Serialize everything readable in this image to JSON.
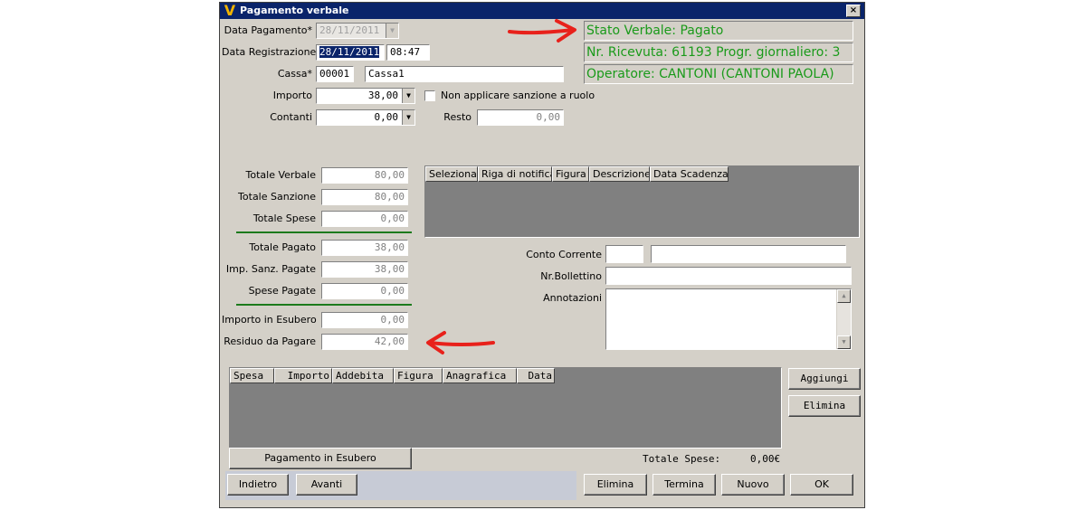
{
  "window": {
    "title": "Pagamento verbale",
    "close_glyph": "×",
    "logo_glyph": "V"
  },
  "form": {
    "data_pagamento_label": "Data Pagamento*",
    "data_pagamento_value": "28/11/2011",
    "data_registrazione_label": "Data Registrazione",
    "data_registrazione_date": "28/11/2011",
    "data_registrazione_time": "08:47",
    "cassa_label": "Cassa*",
    "cassa_code": "00001",
    "cassa_name": "Cassa1",
    "importo_label": "Importo",
    "importo_value": "38,00",
    "non_applicare_label": "Non applicare sanzione a ruolo",
    "contanti_label": "Contanti",
    "contanti_value": "0,00",
    "resto_label": "Resto",
    "resto_value": "0,00"
  },
  "status": {
    "stato": "Stato Verbale: Pagato",
    "ricevuta": "Nr. Ricevuta: 61193 Progr. giornaliero: 3",
    "operatore": "Operatore: CANTONI (CANTONI PAOLA)"
  },
  "totals": {
    "totale_verbale_label": "Totale Verbale",
    "totale_verbale": "80,00",
    "totale_sanzione_label": "Totale Sanzione",
    "totale_sanzione": "80,00",
    "totale_spese_label": "Totale Spese",
    "totale_spese": "0,00",
    "totale_pagato_label": "Totale Pagato",
    "totale_pagato": "38,00",
    "imp_sanz_pagate_label": "Imp. Sanz. Pagate",
    "imp_sanz_pagate": "38,00",
    "spese_pagate_label": "Spese Pagate",
    "spese_pagate": "0,00",
    "importo_esubero_label": "Importo in Esubero",
    "importo_esubero": "0,00",
    "residuo_label": "Residuo da Pagare",
    "residuo": "42,00"
  },
  "notifica_grid": {
    "columns": [
      "Seleziona",
      "Riga di notifica",
      "Figura",
      "Descrizione",
      "Data Scadenza"
    ]
  },
  "bank": {
    "conto_corrente_label": "Conto Corrente",
    "conto_corrente_code": "",
    "conto_corrente_desc": "",
    "nr_bollettino_label": "Nr.Bollettino",
    "nr_bollettino_value": "",
    "annotazioni_label": "Annotazioni",
    "annotazioni_value": ""
  },
  "spese_grid": {
    "columns": [
      "Spesa",
      "Importo",
      "Addebita",
      "Figura",
      "Anagrafica",
      "Data"
    ],
    "totale_label": "Totale Spese:",
    "totale_value": "0,00€"
  },
  "buttons": {
    "aggiungi": "Aggiungi",
    "elimina_side": "Elimina",
    "pagamento_esubero": "Pagamento in Esubero",
    "indietro": "Indietro",
    "avanti": "Avanti",
    "elimina": "Elimina",
    "termina": "Termina",
    "nuovo": "Nuovo",
    "ok": "OK"
  },
  "icons": {
    "dropdown": "▼",
    "scroll_up": "▲",
    "scroll_down": "▼"
  },
  "colors": {
    "title_bar": "#0a246a",
    "status_text": "#1a9a1a",
    "annotation_arrow": "#e8211b",
    "window_bg": "#d4d0c8",
    "grid_bg": "#808080"
  }
}
